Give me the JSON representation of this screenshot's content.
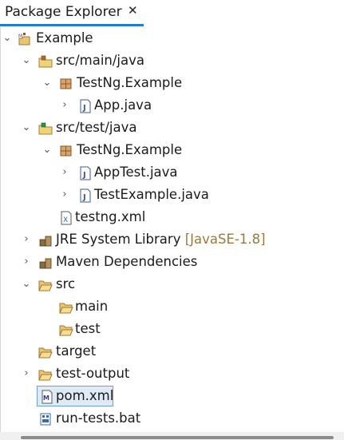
{
  "tab": {
    "title": "Package Explorer",
    "close_glyph": "✕"
  },
  "tree": {
    "project": {
      "label": "Example",
      "arrow": "⌄"
    },
    "src_main_java": {
      "label": "src/main/java",
      "arrow": "⌄"
    },
    "pkg_main": {
      "label": "TestNg.Example",
      "arrow": "⌄"
    },
    "app_java": {
      "label": "App.java",
      "arrow": "›"
    },
    "src_test_java": {
      "label": "src/test/java",
      "arrow": "⌄"
    },
    "pkg_test": {
      "label": "TestNg.Example",
      "arrow": "⌄"
    },
    "apptest_java": {
      "label": "AppTest.java",
      "arrow": "›"
    },
    "testexample_java": {
      "label": "TestExample.java",
      "arrow": "›"
    },
    "testng_xml": {
      "label": "testng.xml"
    },
    "jre": {
      "label": "JRE System Library",
      "decoration": "[JavaSE-1.8]",
      "arrow": "›"
    },
    "maven": {
      "label": "Maven Dependencies",
      "arrow": "›"
    },
    "src": {
      "label": "src",
      "arrow": "⌄"
    },
    "main": {
      "label": "main"
    },
    "test": {
      "label": "test"
    },
    "target": {
      "label": "target"
    },
    "test_output": {
      "label": "test-output",
      "arrow": "›"
    },
    "pom_xml": {
      "label": "pom.xml",
      "selected": true
    },
    "run_tests": {
      "label": "run-tests.bat"
    }
  },
  "colors": {
    "selection_border": "#6f9fd8",
    "selection_fill": "#dfeaf7",
    "tab_underline": "#1f7fd6",
    "decoration": "#9a7a3c"
  }
}
